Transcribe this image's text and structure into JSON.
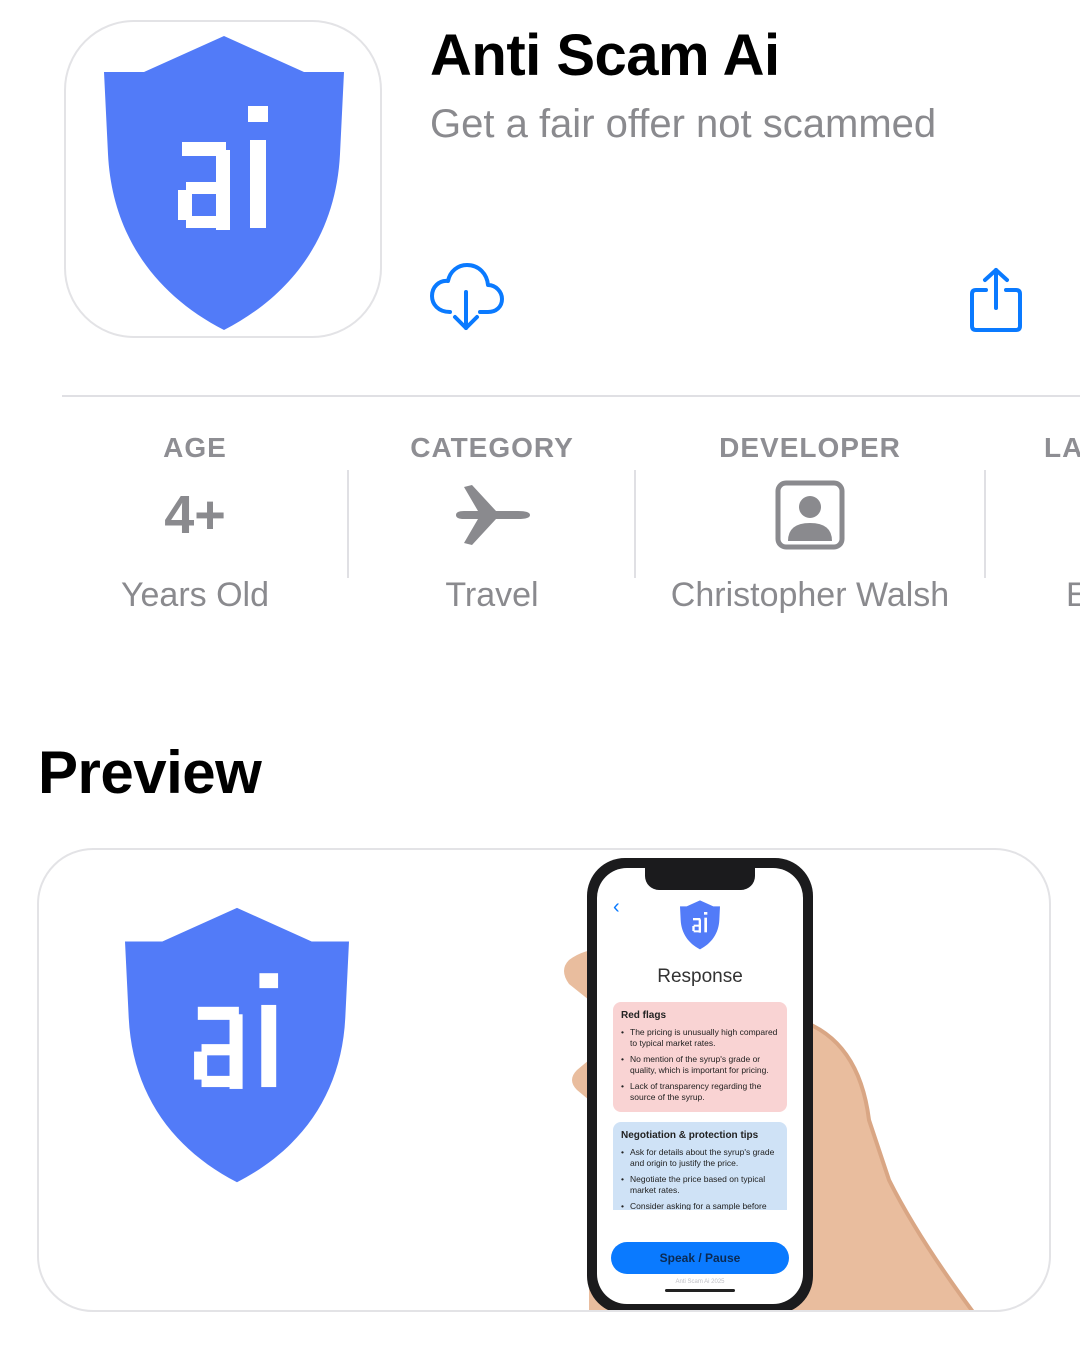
{
  "app": {
    "title": "Anti Scam Ai",
    "subtitle": "Get a fair offer not scammed",
    "icon_name": "shield-ai-logo",
    "logo_text": "ai",
    "accent_color": "#527bf8",
    "link_color": "#0a7aff"
  },
  "actions": {
    "get_icon": "cloud-download-icon",
    "share_icon": "share-icon"
  },
  "info": [
    {
      "header": "AGE",
      "value": "4+",
      "caption": "Years Old"
    },
    {
      "header": "CATEGORY",
      "icon": "airplane-icon",
      "caption": "Travel"
    },
    {
      "header": "DEVELOPER",
      "icon": "person-square-icon",
      "caption": "Christopher Walsh"
    },
    {
      "header": "LA",
      "caption": "E"
    }
  ],
  "preview": {
    "title": "Preview",
    "screen": {
      "logo_text": "ai",
      "heading": "Response",
      "red_flags": {
        "title": "Red flags",
        "items": [
          "The pricing is unusually high compared to typical market rates.",
          "No mention of the syrup's grade or quality, which is important for pricing.",
          "Lack of transparency regarding the source of the syrup."
        ]
      },
      "tips": {
        "title": "Negotiation & protection tips",
        "items": [
          "Ask for details about the syrup's grade and origin to justify the price.",
          "Negotiate the price based on typical market rates.",
          "Consider asking for a sample before"
        ]
      },
      "button": "Speak / Pause",
      "footer": "Anti Scam Ai 2025"
    }
  }
}
